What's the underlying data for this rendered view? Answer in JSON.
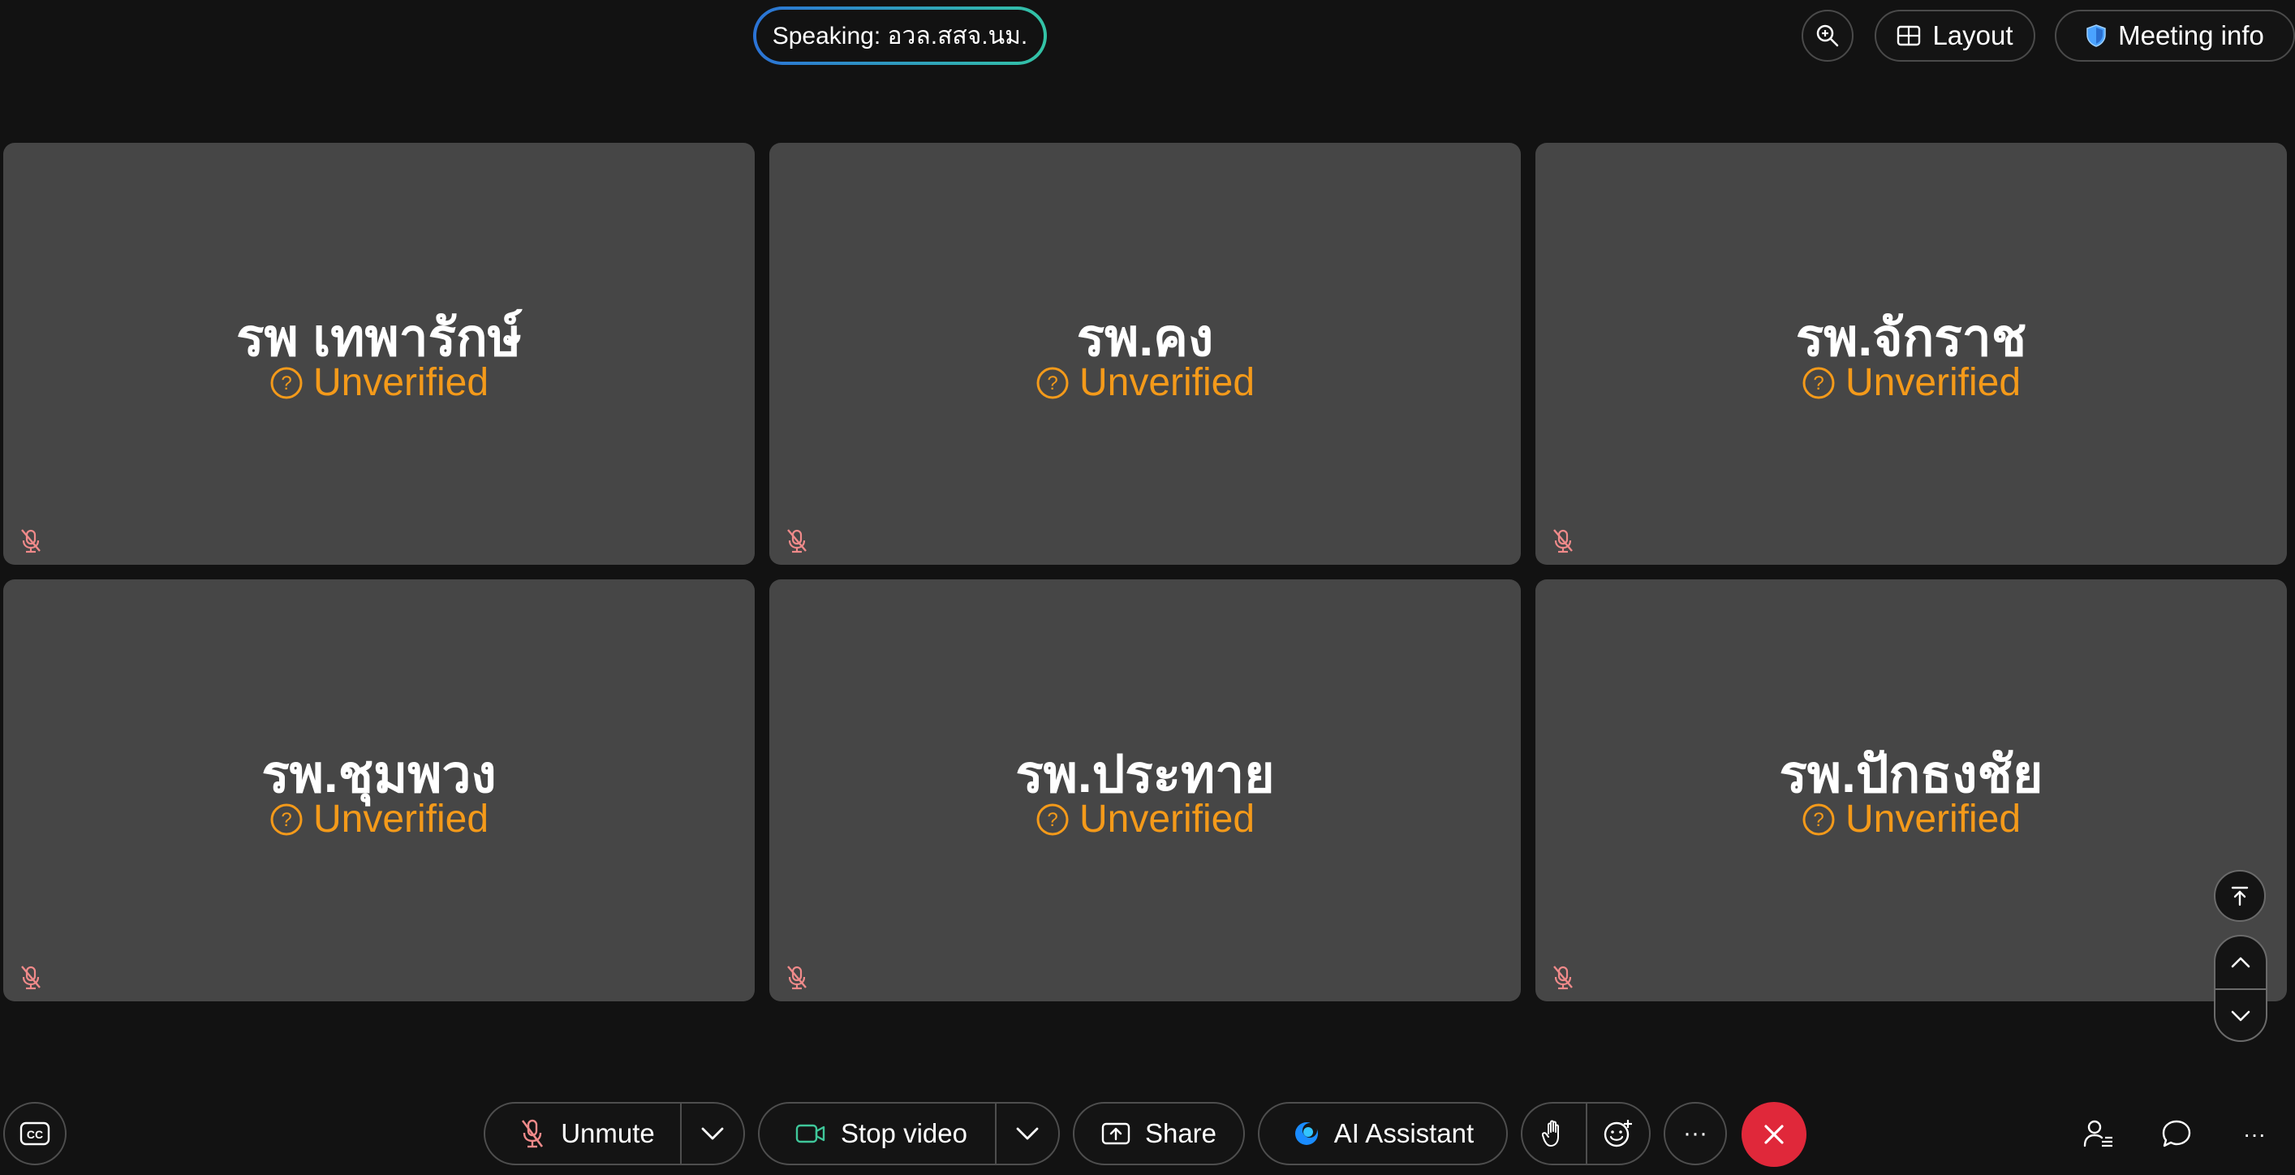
{
  "header": {
    "speaking_label": "Speaking: อวล.สสจ.นม.",
    "layout_label": "Layout",
    "meeting_info_label": "Meeting info"
  },
  "tiles": [
    {
      "name": "รพ เทพารักษ์",
      "status": "Unverified"
    },
    {
      "name": "รพ.คง",
      "status": "Unverified"
    },
    {
      "name": "รพ.จักราช",
      "status": "Unverified"
    },
    {
      "name": "รพ.ชุมพวง",
      "status": "Unverified"
    },
    {
      "name": "รพ.ประทาย",
      "status": "Unverified"
    },
    {
      "name": "รพ.ปักธงชัย",
      "status": "Unverified"
    }
  ],
  "toolbar": {
    "unmute_label": "Unmute",
    "stop_video_label": "Stop video",
    "share_label": "Share",
    "ai_assistant_label": "AI Assistant",
    "more_label": "···",
    "right_more_label": "···"
  },
  "colors": {
    "background": "#121212",
    "tile": "#464646",
    "unverified": "#f49a1a",
    "muted_mic": "#f08a8a",
    "end_call": "#e0283a",
    "video_icon": "#3fc79a"
  }
}
